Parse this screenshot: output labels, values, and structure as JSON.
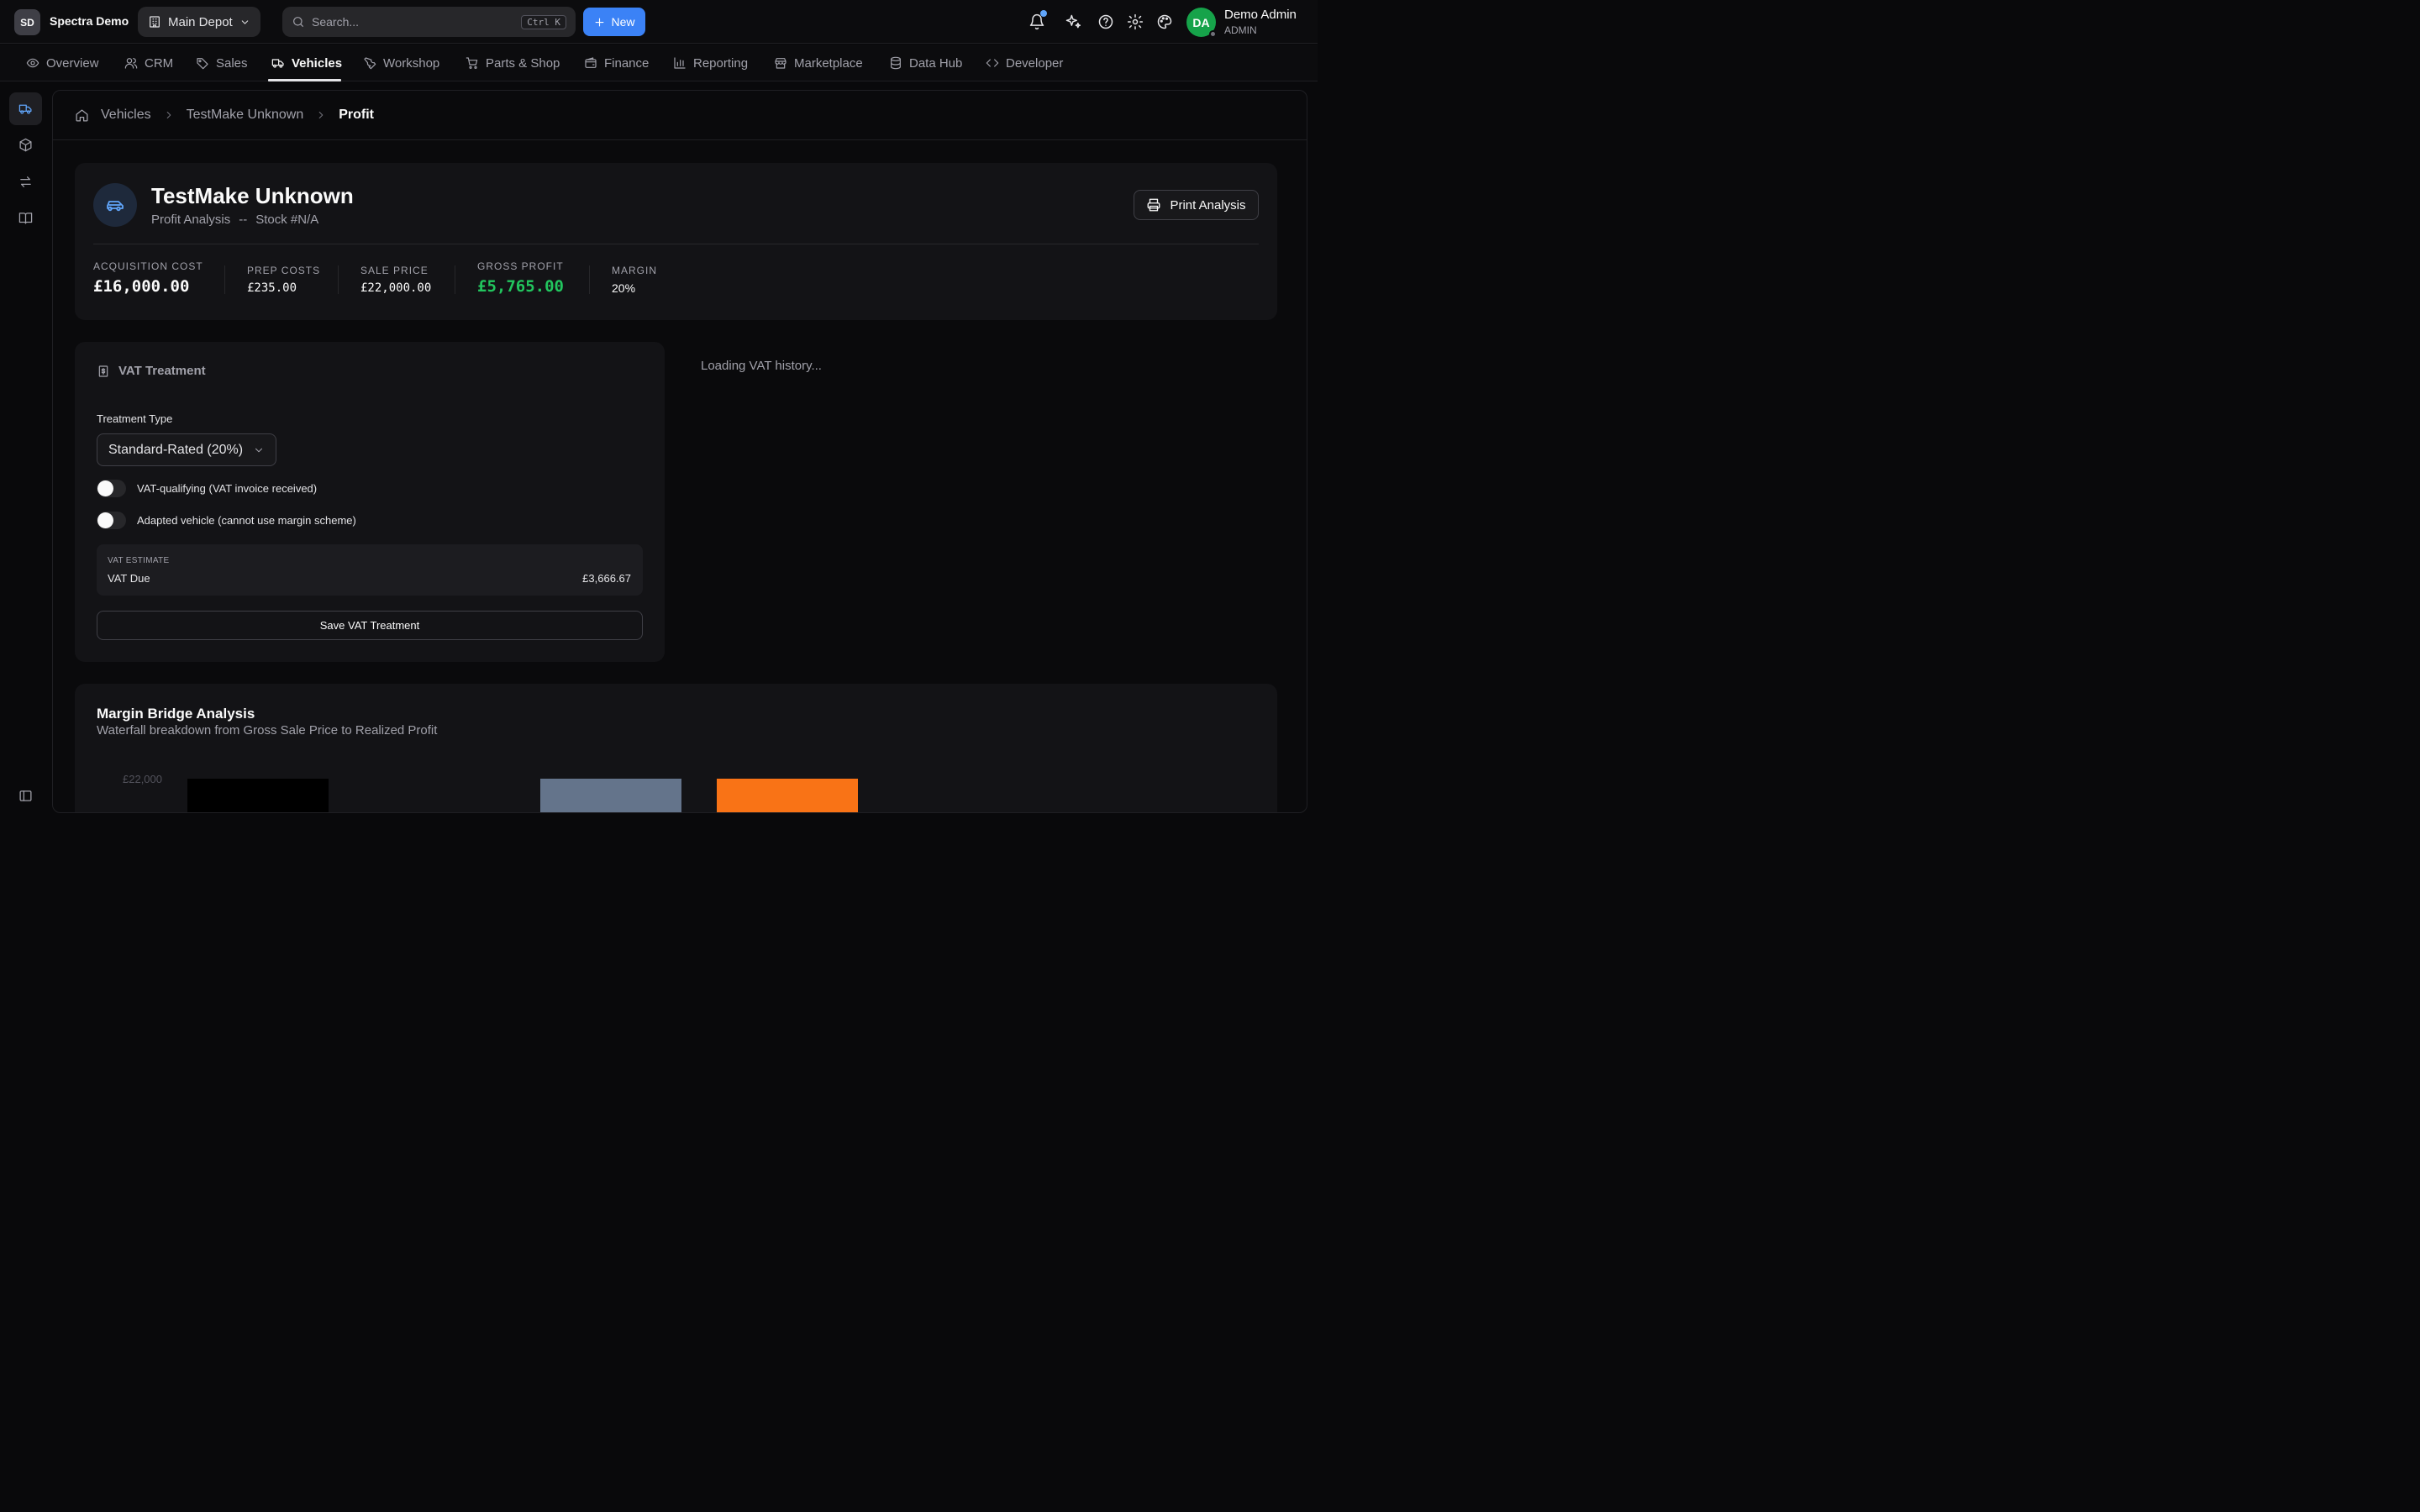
{
  "topbar": {
    "brand_badge": "SD",
    "brand_name": "Spectra Demo",
    "depot": "Main Depot",
    "search_placeholder": "Search...",
    "search_shortcut": "Ctrl K",
    "new_label": "New",
    "user_initials": "DA",
    "user_name": "Demo Admin",
    "user_role": "ADMIN",
    "icons": [
      "bell-icon",
      "sparkles-icon",
      "help-icon",
      "settings-icon",
      "palette-icon"
    ]
  },
  "nav": {
    "items": [
      {
        "label": "Overview",
        "icon": "eye-icon"
      },
      {
        "label": "CRM",
        "icon": "users-icon"
      },
      {
        "label": "Sales",
        "icon": "tag-icon"
      },
      {
        "label": "Vehicles",
        "icon": "truck-icon"
      },
      {
        "label": "Workshop",
        "icon": "wrench-icon"
      },
      {
        "label": "Parts & Shop",
        "icon": "cart-icon"
      },
      {
        "label": "Finance",
        "icon": "wallet-icon"
      },
      {
        "label": "Reporting",
        "icon": "bar-chart-icon"
      },
      {
        "label": "Marketplace",
        "icon": "store-icon"
      },
      {
        "label": "Data Hub",
        "icon": "database-icon"
      },
      {
        "label": "Developer",
        "icon": "code-icon"
      }
    ],
    "active": "Vehicles"
  },
  "breadcrumb": {
    "items": [
      "Vehicles",
      "TestMake Unknown",
      "Profit"
    ]
  },
  "vehicle": {
    "title": "TestMake Unknown",
    "subtitle": "Profit Analysis",
    "separator": "--",
    "stock": "Stock #N/A",
    "print_label": "Print Analysis"
  },
  "stats": [
    {
      "label": "Acquisition Cost",
      "value": "£16,000.00"
    },
    {
      "label": "Prep Costs",
      "value": "£235.00"
    },
    {
      "label": "Sale Price",
      "value": "£22,000.00"
    },
    {
      "label": "Gross Profit",
      "value": "£5,765.00"
    },
    {
      "label": "Margin",
      "value": "20%"
    }
  ],
  "vat": {
    "title": "VAT Treatment",
    "treatment_label": "Treatment Type",
    "treatment_value": "Standard-Rated (20%)",
    "toggle_1": "VAT-qualifying (VAT invoice received)",
    "toggle_2": "Adapted vehicle (cannot use margin scheme)",
    "estimate_label": "VAT ESTIMATE",
    "estimate_name": "VAT Due",
    "estimate_value": "£3,666.67",
    "save_label": "Save VAT Treatment"
  },
  "vat_history": {
    "loading": "Loading VAT history..."
  },
  "margin_bridge": {
    "title": "Margin Bridge Analysis",
    "subtitle": "Waterfall breakdown from Gross Sale Price to Realized Profit"
  },
  "chart_data": {
    "type": "bar",
    "ytick_top": "£22,000",
    "bars": [
      {
        "color": "#000000",
        "top_value": 22000
      },
      {
        "color": "#64748b",
        "top_value": 22000
      },
      {
        "color": "#f97316",
        "top_value": 22000
      }
    ]
  },
  "colors": {
    "accent": "#3b82f6",
    "profit": "#22c55e",
    "avatar": "#16a34a"
  }
}
